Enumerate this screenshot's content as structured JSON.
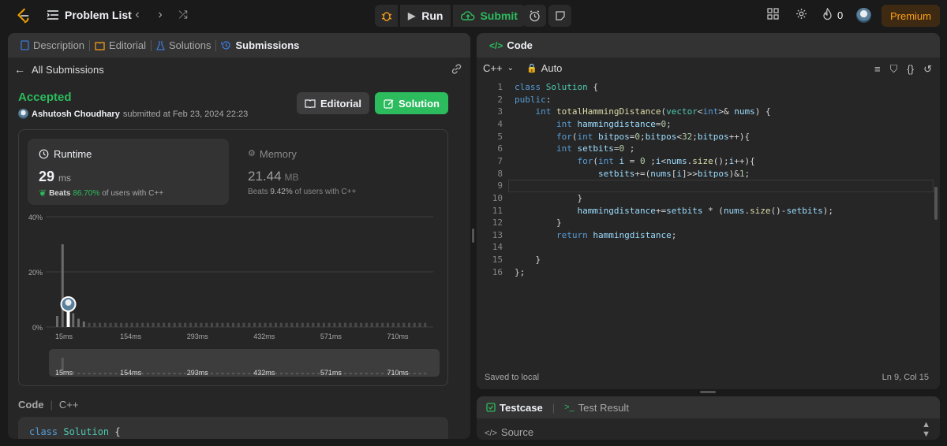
{
  "topbar": {
    "problem_list": "Problem List",
    "run": "Run",
    "submit": "Submit",
    "streak": "0",
    "premium": "Premium"
  },
  "left_tabs": [
    {
      "label": "Description"
    },
    {
      "label": "Editorial"
    },
    {
      "label": "Solutions"
    },
    {
      "label": "Submissions"
    }
  ],
  "submission": {
    "back": "All Submissions",
    "status": "Accepted",
    "author": "Ashutosh Choudhary",
    "submitted_at": "submitted at Feb 23, 2024 22:23",
    "editorial_btn": "Editorial",
    "solution_btn": "Solution"
  },
  "runtime": {
    "label": "Runtime",
    "value": "29",
    "unit": "ms",
    "beats_label": "Beats",
    "beats_pct": "86.70%",
    "beats_suffix": "of users with C++"
  },
  "memory": {
    "label": "Memory",
    "value": "21.44",
    "unit": "MB",
    "beats_label": "Beats",
    "beats_pct": "9.42%",
    "beats_suffix": "of users with C++"
  },
  "chart_data": {
    "type": "bar",
    "ylim": [
      0,
      40
    ],
    "yticks": [
      "40%",
      "20%",
      "0%"
    ],
    "xticks": [
      "15ms",
      "154ms",
      "293ms",
      "432ms",
      "571ms",
      "710ms"
    ],
    "highlight_index": 2,
    "values": [
      4,
      30,
      6,
      5,
      3,
      2,
      1.5,
      1.5,
      1.5,
      1.5,
      1.5,
      1.5,
      1.5,
      1.5,
      1.5,
      1.5,
      1.5,
      1.5,
      1.5,
      1.5,
      1.5,
      1.5,
      1.5,
      1.5,
      1.5,
      1.5,
      1.5,
      1.5,
      1.5,
      1.5,
      1.5,
      1.5,
      1.5,
      1.5,
      1.5,
      1.5,
      1.5,
      1.5,
      1.5,
      1.5,
      1.5,
      1.5,
      1.5,
      1.5,
      1.5,
      1.5,
      1.5,
      1.5,
      1.5,
      1.5,
      1.5,
      1.5,
      1.5,
      1.5,
      1.5,
      1.5,
      1.5,
      1.5,
      1.5,
      1.5,
      1.5,
      1.5,
      1.5,
      1.5,
      1.5,
      1.5,
      1.5,
      1.5,
      1.5,
      1.5
    ]
  },
  "code_section": {
    "label": "Code",
    "lang": "C++",
    "preview_kw": "class",
    "preview_name": "Solution",
    "preview_brace": "{"
  },
  "editor": {
    "title": "Code",
    "lang": "C++",
    "mode": "Auto",
    "saved": "Saved to local",
    "cursor": "Ln 9, Col 15",
    "lines": [
      "class Solution {",
      "public:",
      "    int totalHammingDistance(vector<int>& nums) {",
      "        int hammingdistance=0;",
      "        for(int bitpos=0;bitpos<32;bitpos++){",
      "        int setbits=0 ;",
      "            for(int i = 0 ;i<nums.size();i++){",
      "                setbits+=(nums[i]>>bitpos)&1;",
      "",
      "            }",
      "            hammingdistance+=setbits * (nums.size()-setbits);",
      "        }",
      "        return hammingdistance;",
      "",
      "    }",
      "};"
    ]
  },
  "bottom": {
    "testcase": "Testcase",
    "test_result": "Test Result",
    "source": "Source"
  }
}
